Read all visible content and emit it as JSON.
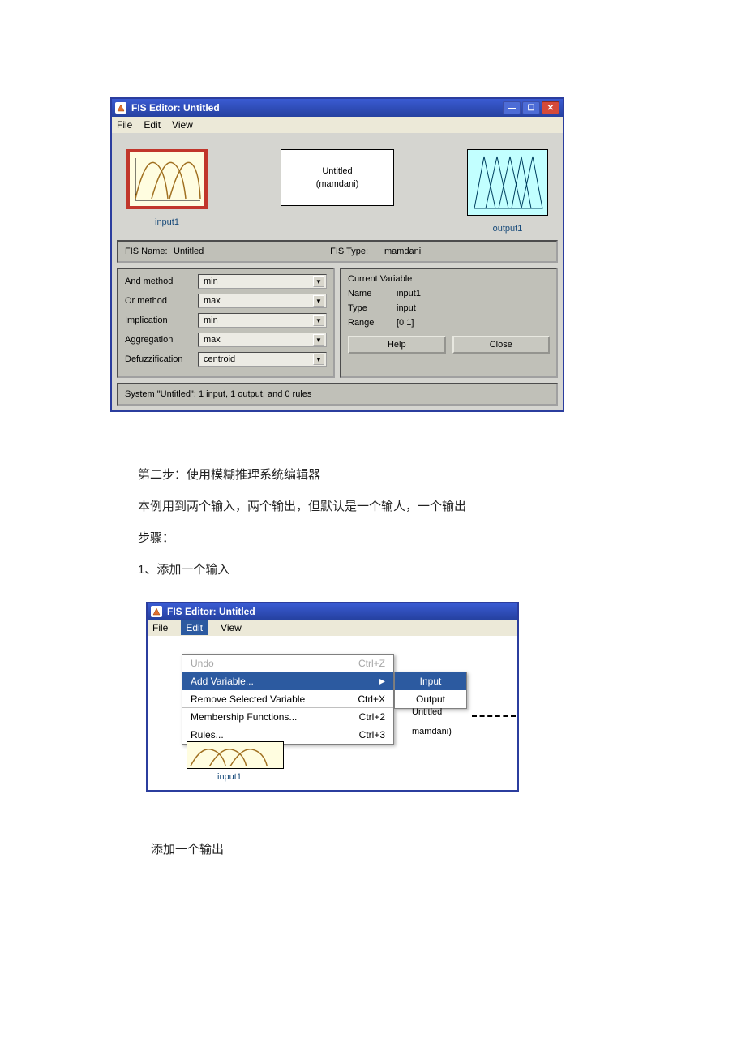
{
  "window1": {
    "title": "FIS Editor: Untitled",
    "menubar": {
      "file": "File",
      "edit": "Edit",
      "view": "View"
    },
    "canvas": {
      "input_label": "input1",
      "output_label": "output1",
      "mid_name": "Untitled",
      "mid_type": "(mamdani)"
    },
    "info_row": {
      "fis_name_label": "FIS Name:",
      "fis_name_value": "Untitled",
      "fis_type_label": "FIS Type:",
      "fis_type_value": "mamdani"
    },
    "methods": {
      "and_label": "And method",
      "and_value": "min",
      "or_label": "Or method",
      "or_value": "max",
      "imp_label": "Implication",
      "imp_value": "min",
      "agg_label": "Aggregation",
      "agg_value": "max",
      "def_label": "Defuzzification",
      "def_value": "centroid"
    },
    "curvar": {
      "header": "Current Variable",
      "name_label": "Name",
      "name_value": "input1",
      "type_label": "Type",
      "type_value": "input",
      "range_label": "Range",
      "range_value": "[0 1]",
      "help_btn": "Help",
      "close_btn": "Close"
    },
    "status": "System \"Untitled\": 1 input, 1 output, and 0 rules"
  },
  "doc": {
    "step2": "第二步：使用模糊推理系统编辑器",
    "desc": "本例用到两个输入，两个输出，但默认是一个输人，一个输出",
    "steps_title": "步骤：",
    "s1": "1、添加一个输入"
  },
  "window2": {
    "title": "FIS Editor: Untitled",
    "menubar": {
      "file": "File",
      "edit": "Edit",
      "view": "View"
    },
    "edit_menu": {
      "undo": "Undo",
      "undo_sc": "Ctrl+Z",
      "addvar": "Add Variable...",
      "remove": "Remove Selected Variable",
      "remove_sc": "Ctrl+X",
      "mf": "Membership Functions...",
      "mf_sc": "Ctrl+2",
      "rules": "Rules...",
      "rules_sc": "Ctrl+3"
    },
    "submenu": {
      "input": "Input",
      "output": "Output"
    },
    "behind": {
      "name": "Untitled",
      "type": "mamdani)"
    },
    "input_label": "input1"
  },
  "doc2": {
    "add_output": "添加一个输出"
  }
}
